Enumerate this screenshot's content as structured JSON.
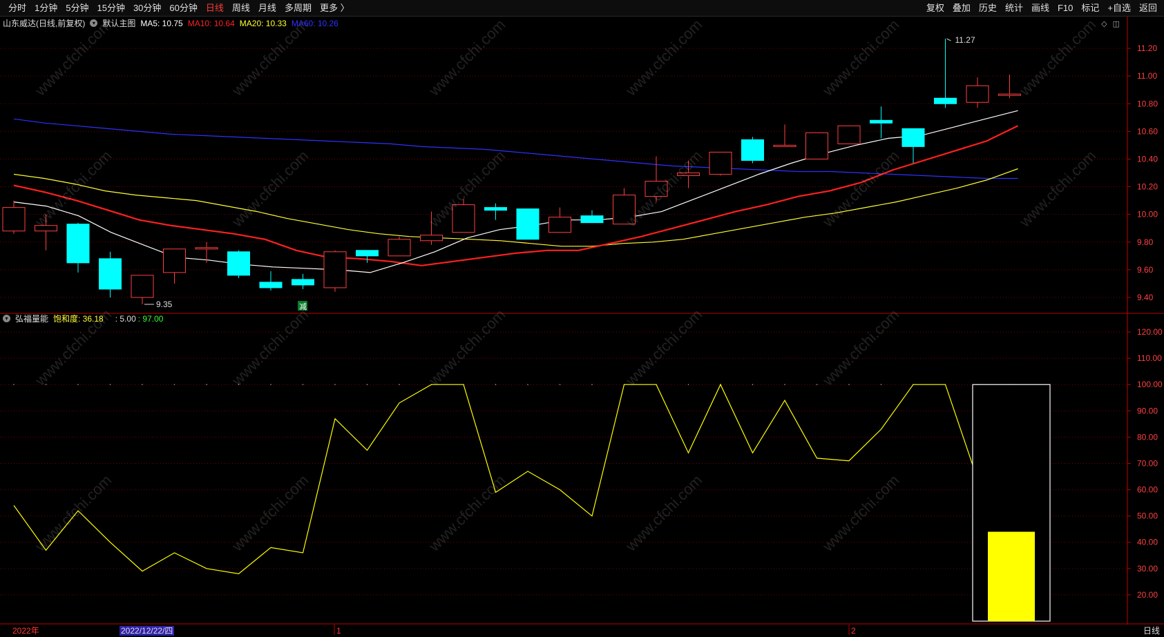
{
  "toolbar": {
    "tabs": [
      {
        "label": "分时",
        "active": false
      },
      {
        "label": "1分钟",
        "active": false
      },
      {
        "label": "5分钟",
        "active": false
      },
      {
        "label": "15分钟",
        "active": false
      },
      {
        "label": "30分钟",
        "active": false
      },
      {
        "label": "60分钟",
        "active": false
      },
      {
        "label": "日线",
        "active": true
      },
      {
        "label": "周线",
        "active": false
      },
      {
        "label": "月线",
        "active": false
      },
      {
        "label": "多周期",
        "active": false
      },
      {
        "label": "更多 〉",
        "active": false
      }
    ],
    "tools": [
      "复权",
      "叠加",
      "历史",
      "统计",
      "画线",
      "F10",
      "标记",
      "+自选",
      "返回"
    ]
  },
  "main_legend": {
    "stock": "山东威达(日线,前复权)",
    "template": "默认主图",
    "ma5": "MA5: 10.75",
    "ma10": "MA10: 10.64",
    "ma20": "MA20: 10.33",
    "ma60": "MA60: 10.26"
  },
  "sub_legend": {
    "name": "弘福量能",
    "saturation": "饱和度: 36.18",
    "v1": ": 5.00",
    "v2": ": 97.00"
  },
  "annotations": {
    "high": "11.27",
    "low": "9.35",
    "marker": "减"
  },
  "bottom": {
    "year": "2022年",
    "date": "2022/12/22/四",
    "m1": "1",
    "m2": "2",
    "period": "日线"
  },
  "watermark": "www.cfchi.com",
  "colors": {
    "up": "#ff4040",
    "down": "#00ffff",
    "ma5": "#ffffff",
    "ma10": "#ff2020",
    "ma20": "#ffff33",
    "ma60": "#3030ff",
    "osc": "#ffff00",
    "grid": "#7a0000",
    "axis": "#c00000"
  },
  "chart_data": [
    {
      "type": "candlestick",
      "title": "山东威达(日线,前复权)",
      "ylim": [
        9.3,
        11.35
      ],
      "yticks": [
        9.4,
        9.6,
        9.8,
        10.0,
        10.2,
        10.4,
        10.6,
        10.8,
        11.0,
        11.2
      ],
      "candles": [
        {
          "o": 9.88,
          "h": 10.1,
          "l": 9.86,
          "c": 10.05
        },
        {
          "o": 9.88,
          "h": 10.0,
          "l": 9.74,
          "c": 9.92
        },
        {
          "o": 9.93,
          "h": 9.94,
          "l": 9.58,
          "c": 9.65
        },
        {
          "o": 9.68,
          "h": 9.73,
          "l": 9.4,
          "c": 9.46
        },
        {
          "o": 9.4,
          "h": 9.56,
          "l": 9.35,
          "c": 9.56
        },
        {
          "o": 9.58,
          "h": 9.75,
          "l": 9.5,
          "c": 9.75
        },
        {
          "o": 9.75,
          "h": 9.8,
          "l": 9.65,
          "c": 9.76
        },
        {
          "o": 9.73,
          "h": 9.74,
          "l": 9.54,
          "c": 9.56
        },
        {
          "o": 9.51,
          "h": 9.59,
          "l": 9.45,
          "c": 9.47
        },
        {
          "o": 9.53,
          "h": 9.57,
          "l": 9.46,
          "c": 9.49
        },
        {
          "o": 9.47,
          "h": 9.74,
          "l": 9.44,
          "c": 9.73
        },
        {
          "o": 9.74,
          "h": 9.74,
          "l": 9.65,
          "c": 9.7
        },
        {
          "o": 9.7,
          "h": 9.84,
          "l": 9.7,
          "c": 9.82
        },
        {
          "o": 9.81,
          "h": 10.02,
          "l": 9.78,
          "c": 9.85
        },
        {
          "o": 9.87,
          "h": 10.11,
          "l": 9.87,
          "c": 10.07
        },
        {
          "o": 10.05,
          "h": 10.08,
          "l": 9.96,
          "c": 10.03
        },
        {
          "o": 10.04,
          "h": 10.04,
          "l": 9.82,
          "c": 9.82
        },
        {
          "o": 9.87,
          "h": 10.05,
          "l": 9.87,
          "c": 9.98
        },
        {
          "o": 9.99,
          "h": 10.03,
          "l": 9.94,
          "c": 9.94
        },
        {
          "o": 9.93,
          "h": 10.19,
          "l": 9.93,
          "c": 10.14
        },
        {
          "o": 10.13,
          "h": 10.42,
          "l": 10.09,
          "c": 10.24
        },
        {
          "o": 10.28,
          "h": 10.39,
          "l": 10.19,
          "c": 10.3
        },
        {
          "o": 10.29,
          "h": 10.45,
          "l": 10.28,
          "c": 10.45
        },
        {
          "o": 10.54,
          "h": 10.56,
          "l": 10.37,
          "c": 10.39
        },
        {
          "o": 10.49,
          "h": 10.65,
          "l": 10.49,
          "c": 10.5
        },
        {
          "o": 10.4,
          "h": 10.59,
          "l": 10.4,
          "c": 10.59
        },
        {
          "o": 10.51,
          "h": 10.64,
          "l": 10.51,
          "c": 10.64
        },
        {
          "o": 10.68,
          "h": 10.78,
          "l": 10.55,
          "c": 10.66
        },
        {
          "o": 10.62,
          "h": 10.62,
          "l": 10.37,
          "c": 10.49
        },
        {
          "o": 10.84,
          "h": 11.27,
          "l": 10.77,
          "c": 10.8
        },
        {
          "o": 10.81,
          "h": 10.99,
          "l": 10.77,
          "c": 10.93
        },
        {
          "o": 10.86,
          "h": 11.01,
          "l": 10.84,
          "c": 10.87
        }
      ],
      "ma5": [
        10.09,
        10.06,
        9.99,
        9.87,
        9.78,
        9.69,
        9.67,
        9.64,
        9.62,
        9.61,
        9.6,
        9.58,
        9.65,
        9.73,
        9.83,
        9.89,
        9.92,
        9.96,
        9.96,
        9.98,
        10.02,
        10.11,
        10.2,
        10.29,
        10.37,
        10.44,
        10.5,
        10.55,
        10.57,
        10.63,
        10.69,
        10.75
      ],
      "ma10": [
        10.21,
        10.16,
        10.1,
        10.03,
        9.96,
        9.92,
        9.89,
        9.86,
        9.82,
        9.74,
        9.69,
        9.68,
        9.66,
        9.63,
        9.66,
        9.69,
        9.72,
        9.74,
        9.74,
        9.79,
        9.84,
        9.9,
        9.96,
        10.02,
        10.07,
        10.13,
        10.17,
        10.23,
        10.32,
        10.39,
        10.46,
        10.53,
        10.64
      ],
      "ma20": [
        10.29,
        10.26,
        10.22,
        10.17,
        10.14,
        10.12,
        10.1,
        10.06,
        10.02,
        9.97,
        9.93,
        9.89,
        9.86,
        9.84,
        9.83,
        9.82,
        9.81,
        9.79,
        9.77,
        9.77,
        9.79,
        9.8,
        9.82,
        9.86,
        9.9,
        9.94,
        9.98,
        10.01,
        10.05,
        10.09,
        10.14,
        10.19,
        10.25,
        10.33
      ],
      "ma60": [
        10.69,
        10.66,
        10.64,
        10.62,
        10.6,
        10.58,
        10.57,
        10.56,
        10.55,
        10.54,
        10.53,
        10.52,
        10.51,
        10.49,
        10.48,
        10.47,
        10.45,
        10.43,
        10.41,
        10.39,
        10.37,
        10.35,
        10.34,
        10.33,
        10.32,
        10.31,
        10.31,
        10.3,
        10.29,
        10.28,
        10.27,
        10.26,
        10.26
      ]
    },
    {
      "type": "line",
      "title": "弘福量能",
      "ylim": [
        10,
        125
      ],
      "yticks": [
        20.0,
        30.0,
        40.0,
        50.0,
        60.0,
        70.0,
        80.0,
        90.0,
        100.0,
        110.0,
        120.0
      ],
      "values": [
        54,
        37,
        52,
        40,
        29,
        36,
        30,
        28,
        38,
        36,
        87,
        75,
        93,
        100,
        100,
        59,
        67,
        60,
        50,
        100,
        100,
        74,
        100,
        74,
        94,
        72,
        71,
        83,
        100,
        100,
        64
      ],
      "bar_value": 44,
      "box_range": [
        10,
        100
      ]
    }
  ]
}
